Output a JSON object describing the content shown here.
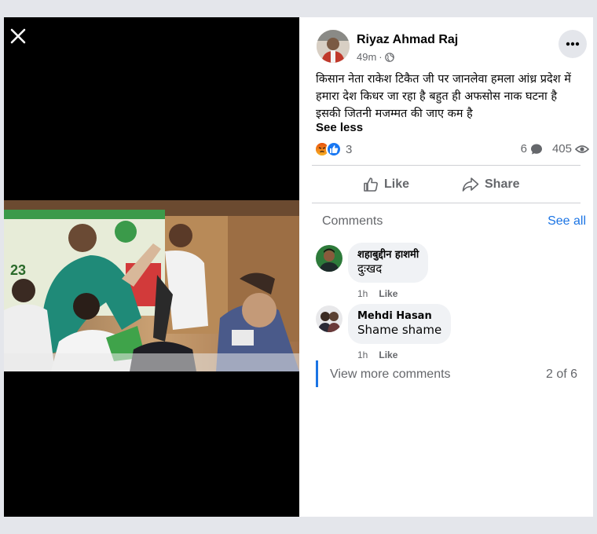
{
  "post": {
    "author": "Riyaz Ahmad Raj",
    "time": "49m",
    "text": "किसान नेता राकेश टिकैत जी पर जानलेवा हमला आंध्र प्रदेश में हमारा देश किधर जा रहा है बहुत ही अफसोस नाक घटना है इसकी जितनी मजम्मत की जाए कम है",
    "see_less": "See less",
    "reaction_count": "3",
    "comment_count": "6",
    "view_count": "405"
  },
  "actions": {
    "like": "Like",
    "share": "Share"
  },
  "comments_section": {
    "header": "Comments",
    "see_all": "See all",
    "items": [
      {
        "name": "शहाबुद्दीन हाशमी",
        "text": "दुःखद",
        "time": "1h",
        "like": "Like"
      },
      {
        "name": "Mehdi Hasan",
        "text": "Shame shame",
        "time": "1h",
        "like": "Like"
      }
    ],
    "view_more": "View more comments",
    "page_count": "2 of 6"
  },
  "colors": {
    "link_blue": "#1b74e4",
    "secondary_text": "#65676b",
    "angry_reaction": "#e9710f",
    "like_reaction": "#1877f2"
  },
  "icons": [
    "close-icon",
    "globe-icon",
    "more-icon",
    "angry-reaction-icon",
    "like-reaction-icon",
    "comment-icon",
    "eye-icon",
    "like-icon",
    "share-icon"
  ]
}
